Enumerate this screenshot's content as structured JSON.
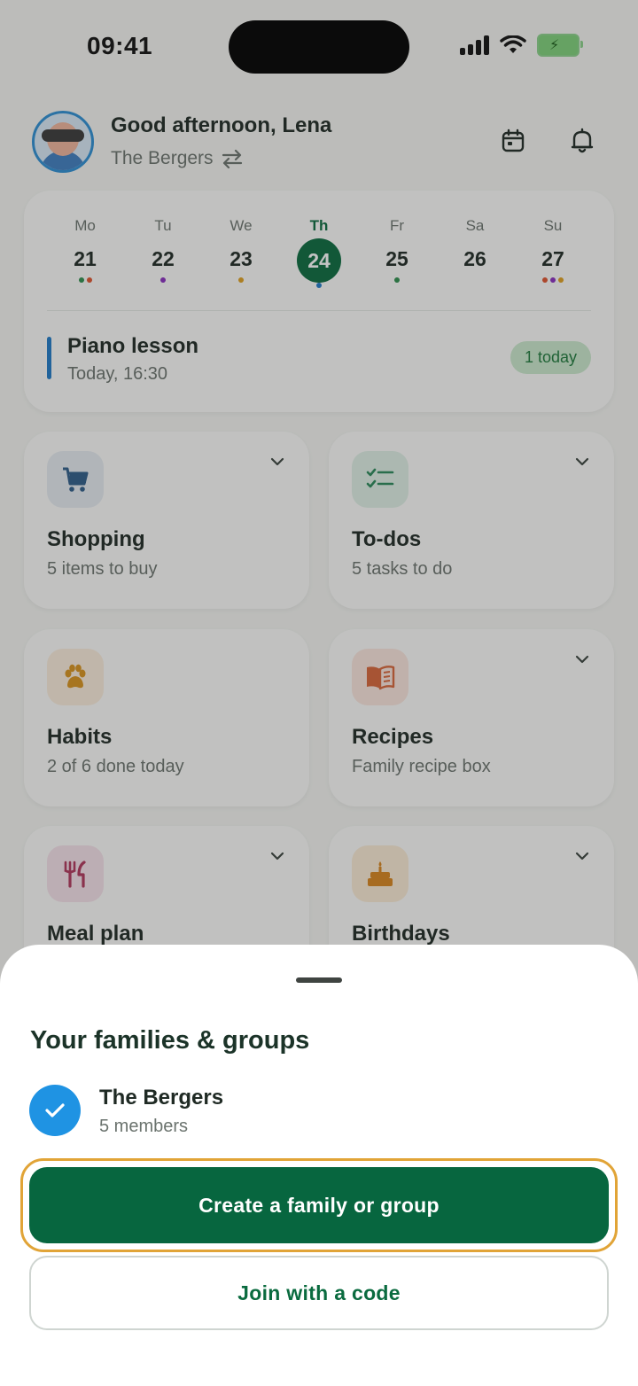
{
  "status_bar": {
    "time": "09:41"
  },
  "header": {
    "greeting": "Good afternoon, Lena",
    "family_name": "The Bergers"
  },
  "calendar": {
    "days": [
      {
        "name": "Mo",
        "date": "21",
        "dots": [
          "#2f8f4e",
          "#e0542f"
        ]
      },
      {
        "name": "Tu",
        "date": "22",
        "dots": [
          "#8a2fbf"
        ]
      },
      {
        "name": "We",
        "date": "23",
        "dots": [
          "#e0a020"
        ]
      },
      {
        "name": "Th",
        "date": "24",
        "dots": [
          "#1f7ac8"
        ],
        "active": true
      },
      {
        "name": "Fr",
        "date": "25",
        "dots": [
          "#2f8f4e"
        ]
      },
      {
        "name": "Sa",
        "date": "26",
        "dots": []
      },
      {
        "name": "Su",
        "date": "27",
        "dots": [
          "#e0542f",
          "#8a2fbf",
          "#e0a020"
        ]
      }
    ],
    "event": {
      "title": "Piano lesson",
      "time": "Today, 16:30"
    },
    "today_badge": "1 today"
  },
  "features": {
    "shopping": {
      "title": "Shopping",
      "subtitle": "5 items to buy",
      "icon": "cart-icon"
    },
    "todos": {
      "title": "To-dos",
      "subtitle": "5 tasks to do",
      "icon": "checklist-icon"
    },
    "habits": {
      "title": "Habits",
      "subtitle": "2 of 6 done today",
      "icon": "paw-icon"
    },
    "recipes": {
      "title": "Recipes",
      "subtitle": "Family recipe box",
      "icon": "book-icon"
    },
    "meal_plan": {
      "title": "Meal plan",
      "icon": "utensils-icon"
    },
    "birthdays": {
      "title": "Birthdays",
      "icon": "cake-icon"
    }
  },
  "sheet": {
    "title": "Your families & groups",
    "groups": [
      {
        "name": "The Bergers",
        "members": "5 members",
        "selected": true
      }
    ],
    "primary_button": "Create a family or group",
    "secondary_button": "Join with a code"
  },
  "colors": {
    "brand_green": "#07663f",
    "selected_blue": "#1f93e3",
    "focus_ring": "#e1a437"
  }
}
